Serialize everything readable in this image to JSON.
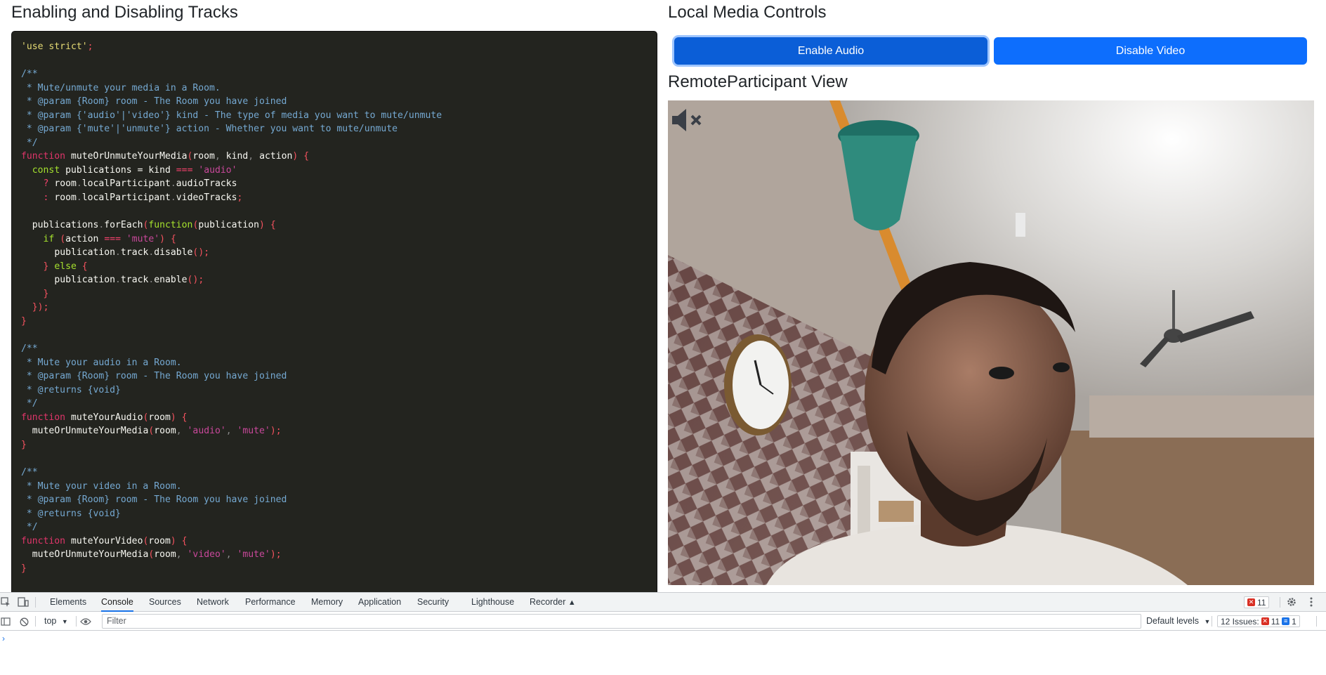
{
  "left": {
    "title": "Enabling and Disabling Tracks"
  },
  "right": {
    "title": "Local Media Controls",
    "enable_audio_label": "Enable Audio",
    "disable_video_label": "Disable Video",
    "remote_title": "RemoteParticipant View"
  },
  "code": {
    "language": "javascript",
    "lines": [
      "'use strict';",
      "",
      "/**",
      " * Mute/unmute your media in a Room.",
      " * @param {Room} room - The Room you have joined",
      " * @param {'audio'|'video'} kind - The type of media you want to mute/unmute",
      " * @param {'mute'|'unmute'} action - Whether you want to mute/unmute",
      " */",
      "function muteOrUnmuteYourMedia(room, kind, action) {",
      "  const publications = kind === 'audio'",
      "    ? room.localParticipant.audioTracks",
      "    : room.localParticipant.videoTracks;",
      "",
      "  publications.forEach(function(publication) {",
      "    if (action === 'mute') {",
      "      publication.track.disable();",
      "    } else {",
      "      publication.track.enable();",
      "    }",
      "  });",
      "}",
      "",
      "/**",
      " * Mute your audio in a Room.",
      " * @param {Room} room - The Room you have joined",
      " * @returns {void}",
      " */",
      "function muteYourAudio(room) {",
      "  muteOrUnmuteYourMedia(room, 'audio', 'mute');",
      "}",
      "",
      "/**",
      " * Mute your video in a Room.",
      " * @param {Room} room - The Room you have joined",
      " * @returns {void}",
      " */",
      "function muteYourVideo(room) {",
      "  muteOrUnmuteYourMedia(room, 'video', 'mute');",
      "}"
    ]
  },
  "video": {
    "muted_indicator_icon": "speaker-muted-icon"
  },
  "devtools": {
    "tabs": [
      "Elements",
      "Console",
      "Sources",
      "Network",
      "Performance",
      "Memory",
      "Application",
      "Security",
      "Lighthouse",
      "Recorder"
    ],
    "active_tab": "Console",
    "error_count": "11",
    "context": "top",
    "filter_placeholder": "Filter",
    "levels": "Default levels",
    "issues_label": "12 Issues:",
    "issues_errors": "11",
    "issues_info": "1",
    "prompt": "›"
  },
  "colors": {
    "button_primary": "#0d6efd",
    "code_background": "#23241f",
    "devtools_accent": "#1a73e8"
  }
}
